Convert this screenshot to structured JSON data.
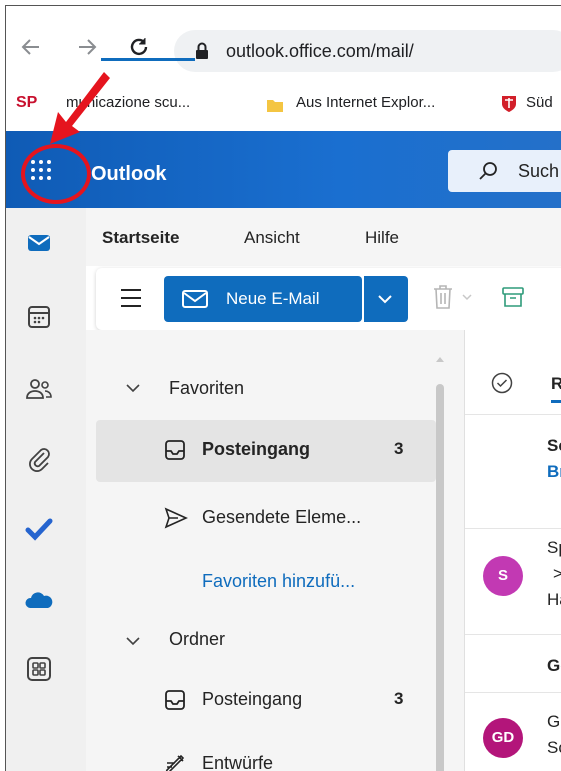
{
  "browser": {
    "url": "outlook.office.com/mail/",
    "bookmarks": [
      {
        "label": "municazione scu..."
      },
      {
        "label": "Aus Internet Explor..."
      },
      {
        "label": "Süd"
      }
    ]
  },
  "app": {
    "title": "Outlook",
    "search_placeholder": "Such"
  },
  "ribbon": {
    "tabs": [
      "Startseite",
      "Ansicht",
      "Hilfe"
    ],
    "new_mail_label": "Neue E-Mail"
  },
  "folders": {
    "favorites_header": "Favoriten",
    "favorites": [
      {
        "label": "Posteingang",
        "count": "3"
      },
      {
        "label": "Gesendete Eleme..."
      }
    ],
    "add_favorites": "Favoriten hinzufü...",
    "folders_header": "Ordner",
    "folder_items": [
      {
        "label": "Posteingang",
        "count": "3"
      },
      {
        "label": "Entwürfe"
      }
    ]
  },
  "messages": {
    "header_label": "Re",
    "items": [
      {
        "line1": "Sc",
        "line2": "Br"
      },
      {
        "avatar": "S",
        "line1": "Sp",
        "line2": ">",
        "line3": "Ha",
        "color": "#c239b3"
      },
      {
        "line1": "Ge"
      },
      {
        "avatar": "GD",
        "line1": "Gi",
        "line2": "Sc",
        "color": "#b3157a"
      }
    ]
  },
  "colors": {
    "accent": "#0f6cbd",
    "annotation": "#e5141e"
  }
}
